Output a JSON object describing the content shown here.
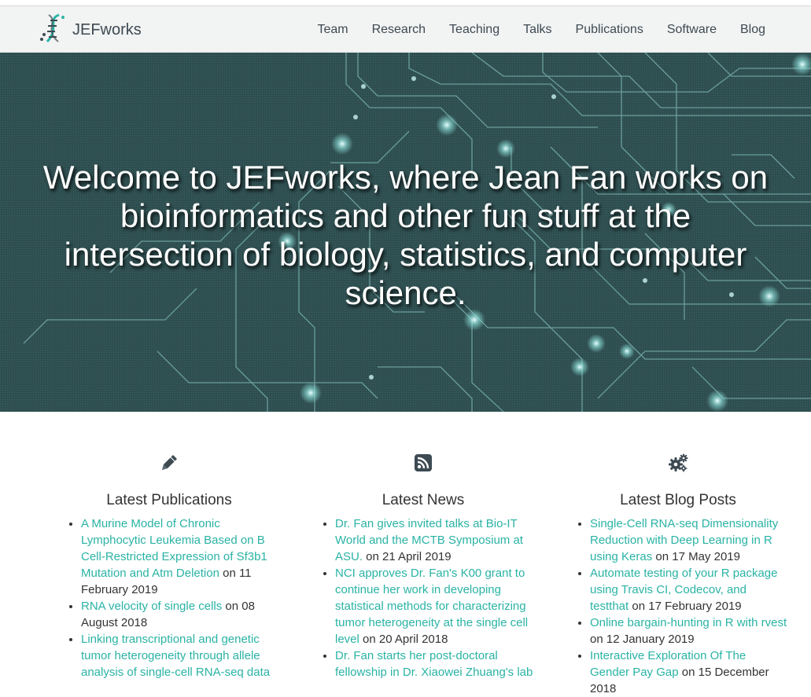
{
  "site": {
    "brand": "JEFworks",
    "colors": {
      "accent": "#2ab3a5",
      "hero_bg": "#2f4e50",
      "nav_bg": "#f2f3f3",
      "text": "#333333",
      "brand_text": "#3d4a52"
    }
  },
  "nav": {
    "items": [
      {
        "label": "Team"
      },
      {
        "label": "Research"
      },
      {
        "label": "Teaching"
      },
      {
        "label": "Talks"
      },
      {
        "label": "Publications"
      },
      {
        "label": "Software"
      },
      {
        "label": "Blog"
      }
    ]
  },
  "hero": {
    "title": "Welcome to JEFworks, where Jean Fan works on bioinformatics and other fun stuff at the intersection of biology, statistics, and computer science."
  },
  "sections": {
    "publications": {
      "icon": "pencil-icon",
      "heading": "Latest Publications",
      "items": [
        {
          "title": "A Murine Model of Chronic Lymphocytic Leukemia Based on B Cell-Restricted Expression of Sf3b1 Mutation and Atm Deletion",
          "date": " on 11 February 2019"
        },
        {
          "title": "RNA velocity of single cells",
          "date": " on 08 August 2018"
        },
        {
          "title": "Linking transcriptional and genetic tumor heterogeneity through allele analysis of single-cell RNA-seq data",
          "date": ""
        }
      ]
    },
    "news": {
      "icon": "rss-icon",
      "heading": "Latest News",
      "items": [
        {
          "title": "Dr. Fan gives invited talks at Bio-IT World and the MCTB Symposium at ASU.",
          "date": " on 21 April 2019"
        },
        {
          "title": "NCI approves Dr. Fan's K00 grant to continue her work in developing statistical methods for characterizing tumor heterogeneity at the single cell level",
          "date": " on 20 April 2018"
        },
        {
          "title": "Dr. Fan starts her post-doctoral fellowship in Dr. Xiaowei Zhuang's lab",
          "date": ""
        }
      ]
    },
    "blog": {
      "icon": "gears-icon",
      "heading": "Latest Blog Posts",
      "items": [
        {
          "title": "Single-Cell RNA-seq Dimensionality Reduction with Deep Learning in R using Keras",
          "date": " on 17 May 2019"
        },
        {
          "title": "Automate testing of your R package using Travis CI, Codecov, and testthat",
          "date": " on 17 February 2019"
        },
        {
          "title": "Online bargain-hunting in R with rvest",
          "date": " on 12 January 2019"
        },
        {
          "title": "Interactive Exploration Of The Gender Pay Gap",
          "date": " on 15 December 2018"
        }
      ]
    }
  }
}
